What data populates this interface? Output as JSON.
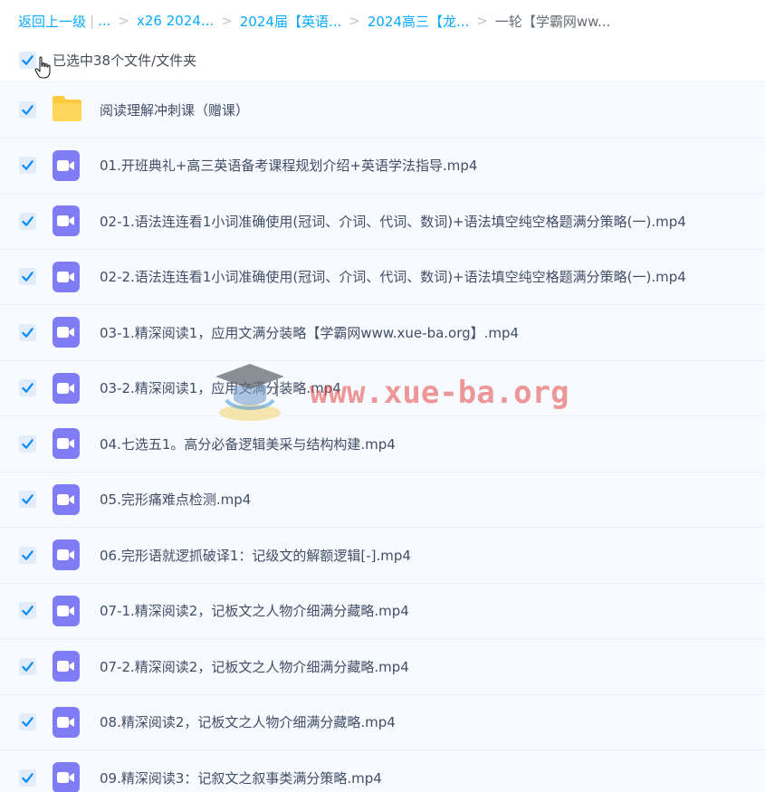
{
  "breadcrumb": {
    "back_label": "返回上一级",
    "bar": "|",
    "ellipsis": "...",
    "sep": ">",
    "crumbs": [
      "x26 2024...",
      "2024届【英语...",
      "2024高三【龙...",
      "一轮【学霸网ww..."
    ]
  },
  "selection": {
    "label": "已选中38个文件/文件夹"
  },
  "items": [
    {
      "name": "阅读理解冲刺课（赠课）",
      "type": "folder"
    },
    {
      "name": "01.开班典礼+高三英语备考课程规划介绍+英语学法指导.mp4",
      "type": "video"
    },
    {
      "name": "02-1.语法连连看1小词准确使用(冠词、介词、代词、数词)+语法填空纯空格题满分策略(一).mp4",
      "type": "video"
    },
    {
      "name": "02-2.语法连连看1小词准确使用(冠词、介词、代词、数词)+语法填空纯空格题满分策略(一).mp4",
      "type": "video"
    },
    {
      "name": "03-1.精深阅读1，应用文满分装略【学霸网www.xue-ba.org】.mp4",
      "type": "video"
    },
    {
      "name": "03-2.精深阅读1，应用文满分装略.mp4",
      "type": "video"
    },
    {
      "name": "04.七选五1。高分必备逻辑美采与结构构建.mp4",
      "type": "video"
    },
    {
      "name": "05.完形痛难点检测.mp4",
      "type": "video"
    },
    {
      "name": "06.完形语就逻抓破译1：记级文的解额逻辑[-].mp4",
      "type": "video"
    },
    {
      "name": "07-1.精深阅读2，记板文之人物介细满分藏略.mp4",
      "type": "video"
    },
    {
      "name": "07-2.精深阅读2，记板文之人物介细满分藏略.mp4",
      "type": "video"
    },
    {
      "name": "08.精深阅读2，记板文之人物介细满分藏略.mp4",
      "type": "video"
    },
    {
      "name": "09.精深阅读3：记叙文之叙事类满分策略.mp4",
      "type": "video"
    }
  ],
  "watermark": {
    "text": "www.xue-ba.org"
  },
  "colors": {
    "accent": "#09aaff",
    "check": "#0a8ef7",
    "video_icon": "#7f7cf6",
    "folder": "#ffc93e",
    "row_bg": "#f7faff"
  }
}
